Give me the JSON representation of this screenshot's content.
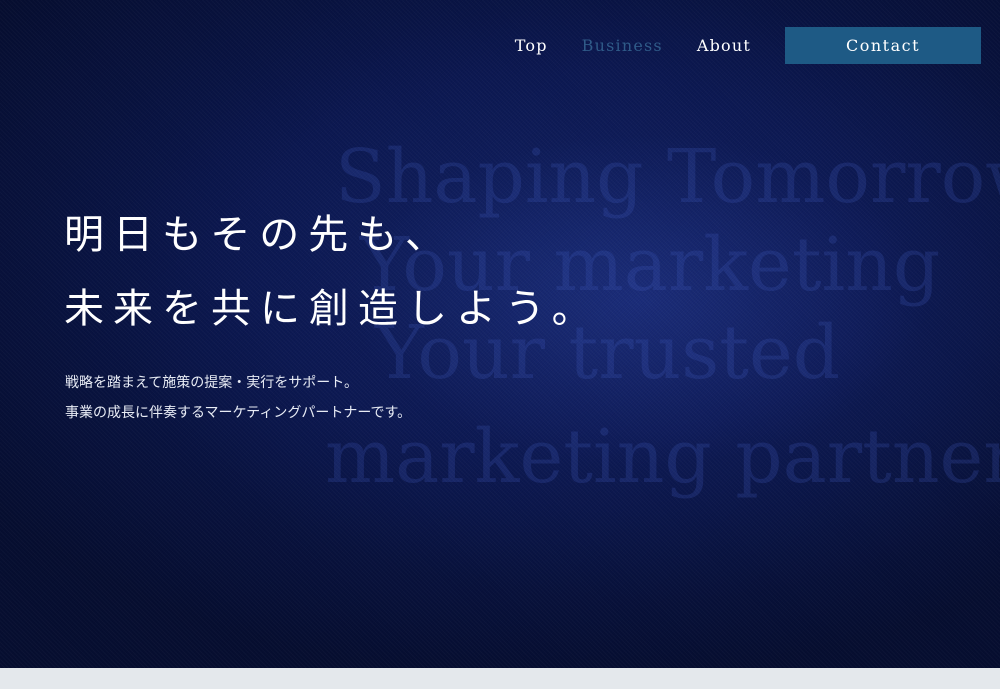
{
  "nav": {
    "items": [
      {
        "label": "Top",
        "active": false
      },
      {
        "label": "Business",
        "active": true
      },
      {
        "label": "About",
        "active": false
      }
    ],
    "contact_label": "Contact"
  },
  "hero": {
    "headline_line1": "明日もその先も、",
    "headline_line2": "未来を共に創造しよう。",
    "lead_line1": "戦略を踏まえて施策の提案・実行をサポート。",
    "lead_line2": "事業の成長に伴奏するマーケティングパートナーです。",
    "background_lines": [
      "Shaping Tomorrow",
      "Your marketing",
      "Your trusted",
      "marketing partner."
    ]
  },
  "colors": {
    "hero_bg": "#0b1750",
    "accent_button": "#1e5a85",
    "nav_active": "#2f5a88",
    "bottom_band": "#e4e8ec"
  }
}
